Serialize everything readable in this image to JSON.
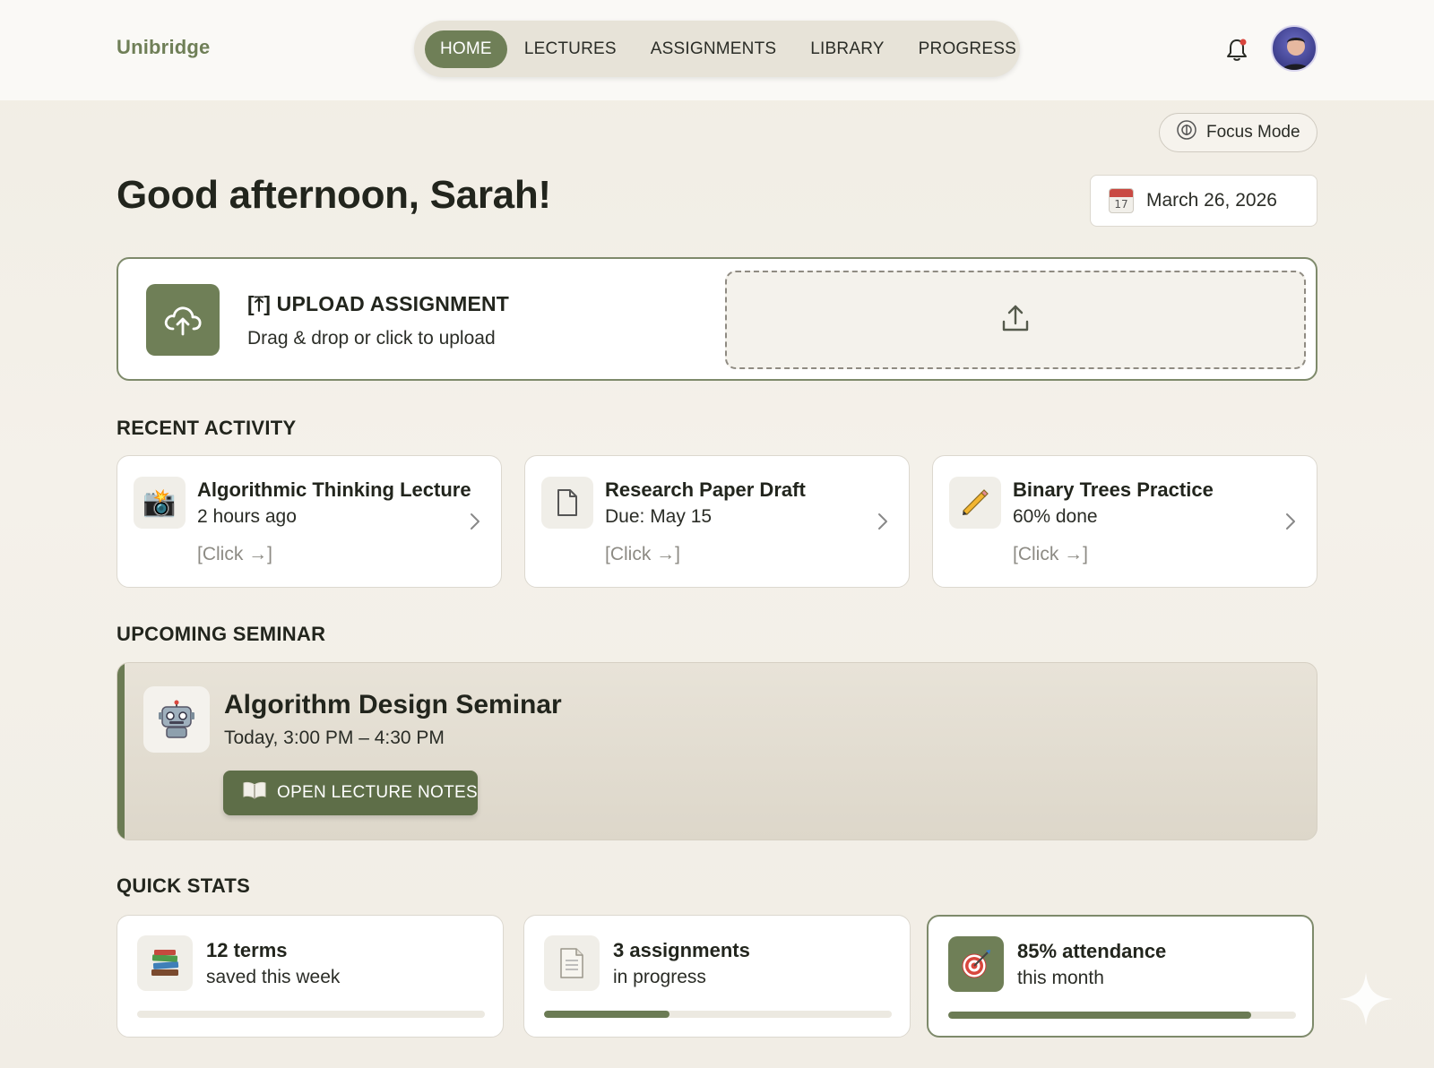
{
  "brand": "Unibridge",
  "nav": {
    "items": [
      {
        "label": "HOME",
        "active": true
      },
      {
        "label": "LECTURES",
        "active": false
      },
      {
        "label": "ASSIGNMENTS",
        "active": false
      },
      {
        "label": "LIBRARY",
        "active": false
      },
      {
        "label": "PROGRESS",
        "active": false
      }
    ]
  },
  "header": {
    "notification_icon": "bell-icon",
    "notification_dot_color": "#d9463d",
    "avatar_icon": "user-avatar"
  },
  "focus_mode": {
    "label": "Focus Mode",
    "icon": "focus-icon"
  },
  "greeting": "Good afternoon, Sarah!",
  "date": {
    "label": "March 26, 2026",
    "calendar_day": "17",
    "icon": "calendar-icon"
  },
  "upload": {
    "title": "[⤒] UPLOAD ASSIGNMENT",
    "subtitle": "Drag & drop or click to upload",
    "icon": "cloud-upload-icon",
    "dropzone_icon": "upload-arrow-icon"
  },
  "recent_activity": {
    "heading": "RECENT ACTIVITY",
    "items": [
      {
        "title": "Algorithmic Thinking Lecture",
        "subtitle": "2 hours ago",
        "link": "[Click →]",
        "icon": "camera-icon",
        "glyph": "📸"
      },
      {
        "title": "Research Paper Draft",
        "subtitle": "Due: May 15",
        "link": "[Click →]",
        "icon": "document-icon",
        "glyph": "🗋"
      },
      {
        "title": "Binary Trees Practice",
        "subtitle": "60% done",
        "link": "[Click →]",
        "icon": "pencil-icon",
        "glyph": "✏"
      }
    ]
  },
  "seminar": {
    "heading": "UPCOMING SEMINAR",
    "title": "Algorithm Design Seminar",
    "time": "Today, 3:00 PM – 4:30 PM",
    "button": "OPEN LECTURE NOTES",
    "icon": "robot-icon",
    "glyph": "🤖",
    "button_icon": "book-icon"
  },
  "quick_stats": {
    "heading": "QUICK STATS",
    "items": [
      {
        "title": "12 terms",
        "subtitle": "saved this week",
        "progress": 0,
        "icon": "books-icon",
        "glyph": "📚"
      },
      {
        "title": "3 assignments",
        "subtitle": "in progress",
        "progress": 0.36,
        "icon": "page-icon",
        "glyph": "📄"
      },
      {
        "title": "85% attendance",
        "subtitle": "this month",
        "progress": 0.87,
        "icon": "target-icon",
        "glyph": "🎯"
      }
    ]
  },
  "colors": {
    "accent": "#6f7f57",
    "accent_dark": "#5e6e48",
    "background": "#f2eee6",
    "card": "#ffffff"
  }
}
